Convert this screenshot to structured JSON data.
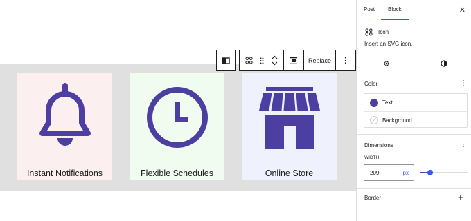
{
  "cards": [
    {
      "caption": "Instant Notifications",
      "icon": "bell-icon",
      "bg": "#fbf0ef"
    },
    {
      "caption": "Flexible Schedules",
      "icon": "clock-icon",
      "bg": "#f0fcef"
    },
    {
      "caption": "Online Store",
      "icon": "store-icon",
      "bg": "#eff2fc"
    }
  ],
  "icon_color": "#4c3fa1",
  "toolbar": {
    "replace_label": "Replace"
  },
  "panel": {
    "tabs": [
      {
        "label": "Post"
      },
      {
        "label": "Block"
      }
    ],
    "block": {
      "name": "Icon",
      "description": "Insert an SVG icon."
    },
    "color": {
      "title": "Color",
      "items": [
        {
          "label": "Text",
          "swatch": "#4c3fa1"
        },
        {
          "label": "Background",
          "swatch": "none"
        }
      ]
    },
    "dimensions": {
      "title": "Dimensions",
      "width_label": "WIDTH",
      "width_value": "209",
      "unit": "px",
      "slider_fraction": 0.2
    },
    "border": {
      "title": "Border"
    }
  }
}
